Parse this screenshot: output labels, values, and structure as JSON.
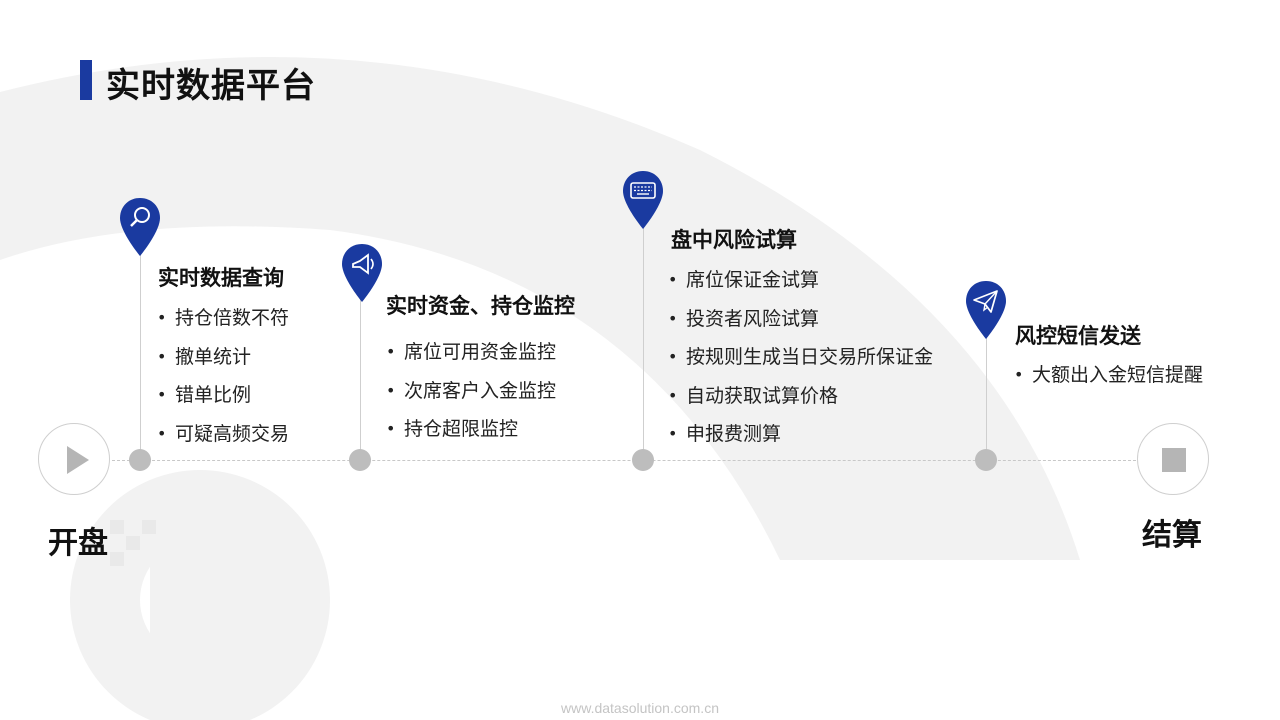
{
  "title": "实时数据平台",
  "start": {
    "label": "开盘",
    "icon": "play-icon"
  },
  "end": {
    "label": "结算",
    "icon": "stop-icon"
  },
  "stages": [
    {
      "icon": "magnifier-icon",
      "heading": "实时数据查询",
      "items": [
        "持仓倍数不符",
        "撤单统计",
        "错单比例",
        "可疑高频交易"
      ]
    },
    {
      "icon": "megaphone-icon",
      "heading": "实时资金、持仓监控",
      "items": [
        "席位可用资金监控",
        "次席客户入金监控",
        "持仓超限监控"
      ]
    },
    {
      "icon": "keyboard-icon",
      "heading": "盘中风险试算",
      "items": [
        "席位保证金试算",
        "投资者风险试算",
        "按规则生成当日交易所保证金",
        "自动获取试算价格",
        "申报费测算"
      ]
    },
    {
      "icon": "paper-plane-icon",
      "heading": "风控短信发送",
      "items": [
        "大额出入金短信提醒"
      ]
    }
  ],
  "footer": "www.datasolution.com.cn",
  "colors": {
    "accent": "#1a3aa0",
    "dot": "#bdbdbd",
    "watermark": "#f0f0f0"
  }
}
